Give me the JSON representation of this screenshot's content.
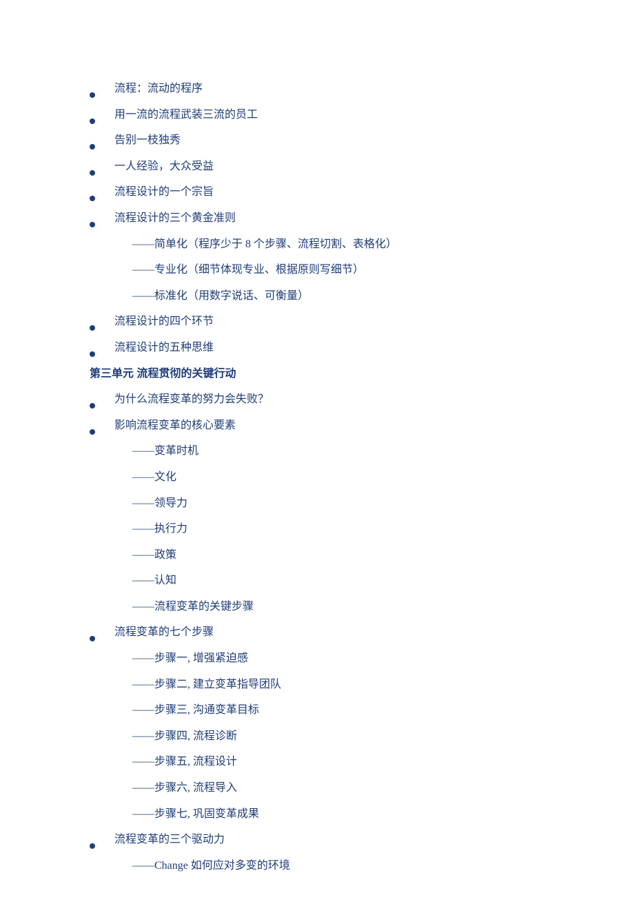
{
  "items": [
    {
      "type": "bullet",
      "text": "流程：流动的程序"
    },
    {
      "type": "bullet",
      "text": "用一流的流程武装三流的员工"
    },
    {
      "type": "bullet",
      "text": "告别一枝独秀"
    },
    {
      "type": "bullet",
      "text": "一人经验，大众受益"
    },
    {
      "type": "bullet",
      "text": "流程设计的一个宗旨"
    },
    {
      "type": "bullet",
      "text": "流程设计的三个黄金准则"
    },
    {
      "type": "sub",
      "text": "——简单化（程序少于 8 个步骤、流程切割、表格化）"
    },
    {
      "type": "sub",
      "text": "——专业化（细节体现专业、根据原则写细节）"
    },
    {
      "type": "sub",
      "text": "——标准化（用数字说话、可衡量）"
    },
    {
      "type": "bullet",
      "text": "流程设计的四个环节"
    },
    {
      "type": "bullet",
      "text": "流程设计的五种思维"
    },
    {
      "type": "heading",
      "text": "第三单元  流程贯彻的关键行动"
    },
    {
      "type": "bullet",
      "text": "为什么流程变革的努力会失败？"
    },
    {
      "type": "bullet",
      "text": "影响流程变革的核心要素"
    },
    {
      "type": "sub",
      "text": "——变革时机"
    },
    {
      "type": "sub",
      "text": "——文化"
    },
    {
      "type": "sub",
      "text": "——领导力"
    },
    {
      "type": "sub",
      "text": "——执行力"
    },
    {
      "type": "sub",
      "text": "——政策"
    },
    {
      "type": "sub",
      "text": "——认知"
    },
    {
      "type": "sub",
      "text": "——流程变革的关键步骤"
    },
    {
      "type": "bullet",
      "text": "流程变革的七个步骤"
    },
    {
      "type": "sub",
      "text": "——步骤一, 增强紧迫感"
    },
    {
      "type": "sub",
      "text": "——步骤二, 建立变革指导团队"
    },
    {
      "type": "sub",
      "text": "——步骤三, 沟通变革目标"
    },
    {
      "type": "sub",
      "text": "——步骤四, 流程诊断"
    },
    {
      "type": "sub",
      "text": "——步骤五, 流程设计"
    },
    {
      "type": "sub",
      "text": "——步骤六, 流程导入"
    },
    {
      "type": "sub",
      "text": "——步骤七, 巩固变革成果"
    },
    {
      "type": "bullet",
      "text": "流程变革的三个驱动力"
    },
    {
      "type": "sub",
      "text": "——Change  如何应对多变的环境"
    }
  ]
}
